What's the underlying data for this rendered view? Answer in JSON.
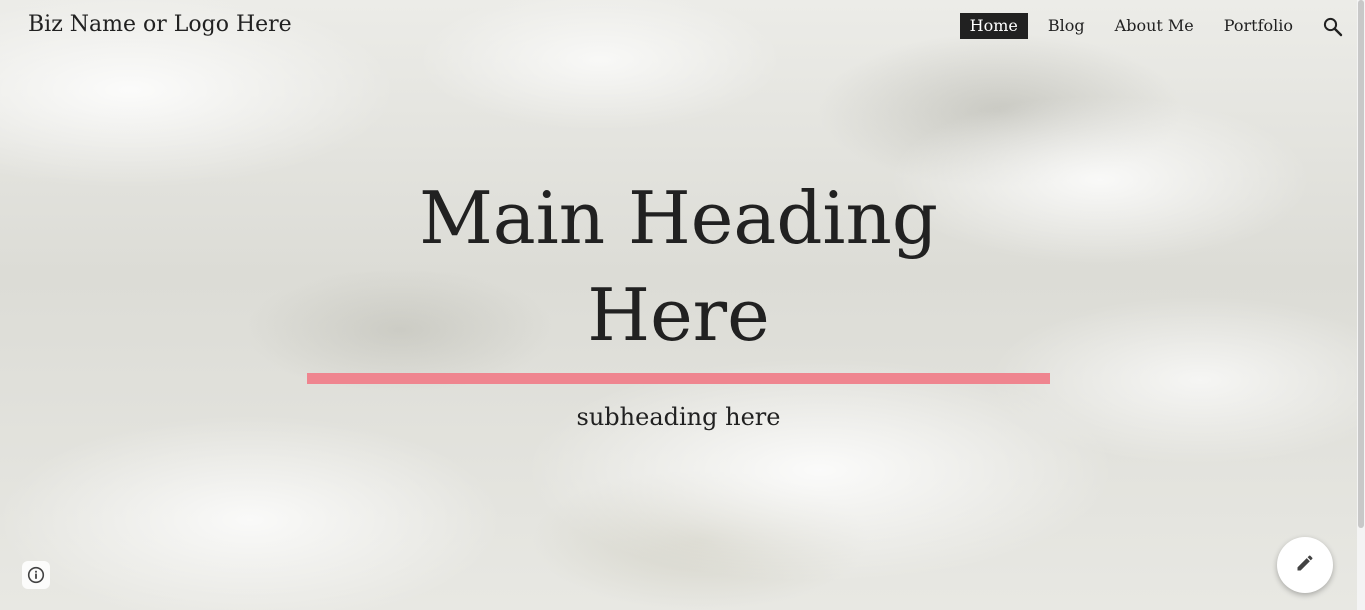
{
  "header": {
    "logo_text": "Biz Name or Logo Here",
    "nav": [
      {
        "label": "Home",
        "active": true
      },
      {
        "label": "Blog",
        "active": false
      },
      {
        "label": "About Me",
        "active": false
      },
      {
        "label": "Portfolio",
        "active": false
      }
    ],
    "search_icon": "search-icon"
  },
  "hero": {
    "heading": "Main Heading Here",
    "subheading": "subheading here",
    "accent_color": "#ef858f"
  },
  "footer": {
    "info_icon": "info-icon",
    "edit_icon": "pencil-icon"
  }
}
